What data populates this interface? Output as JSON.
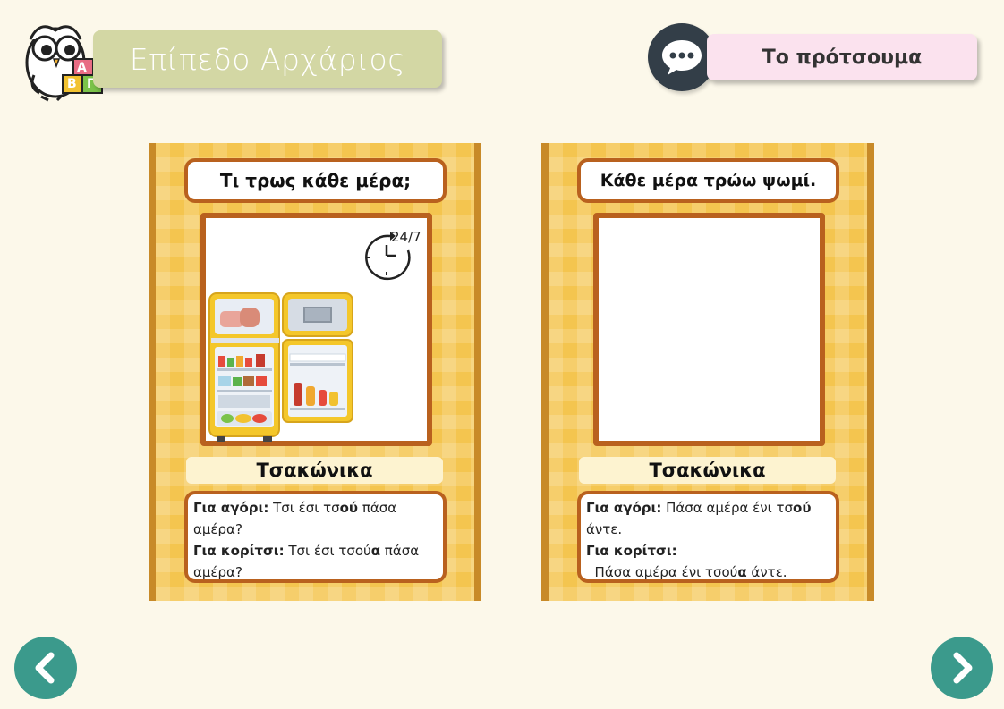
{
  "header": {
    "level_title": "Επίπεδο Αρχάριος",
    "logo_letters": [
      "Α",
      "Β",
      "Γ"
    ],
    "original_button_label": "Το πρότσουμα"
  },
  "cards": [
    {
      "title": "Τι τρως κάθε μέρα;",
      "image_icons": [
        "refrigerator-icon",
        "clock-24-7-icon"
      ],
      "clock_label": "24/7",
      "language": "Τσακώνικα",
      "boy": {
        "label": "Για αγόρι:",
        "pre": " Τσι έσι τσ",
        "bold": "ού",
        "post": " πάσα αμέρα?"
      },
      "girl": {
        "label": "Για κορίτσι:",
        "pre": " Τσι έσι τσού",
        "bold": "α",
        "post": " πάσα αμέρα?"
      }
    },
    {
      "title": "Κάθε μέρα τρώω ψωμί.",
      "language": "Τσακώνικα",
      "boy": {
        "label": "Για αγόρι:",
        "pre": " Πάσα αμέρα ένι τσ",
        "bold": "ού",
        "post": " άντε."
      },
      "girl": {
        "label": "Για κορίτσι:",
        "pre": "  Πάσα αμέρα ένι τσού",
        "bold": "α",
        "post": " άντε."
      }
    }
  ],
  "navigation": {
    "prev_icon": "chevron-left-icon",
    "next_icon": "chevron-right-icon"
  },
  "colors": {
    "background": "#fcf8ea",
    "card_yellow": "#f4c54f",
    "card_border": "#b9611e",
    "level_pill": "#d3d7a4",
    "original_pill": "#fbe2ee",
    "nav_button": "#3b9a8c",
    "chat_button": "#333e48"
  }
}
